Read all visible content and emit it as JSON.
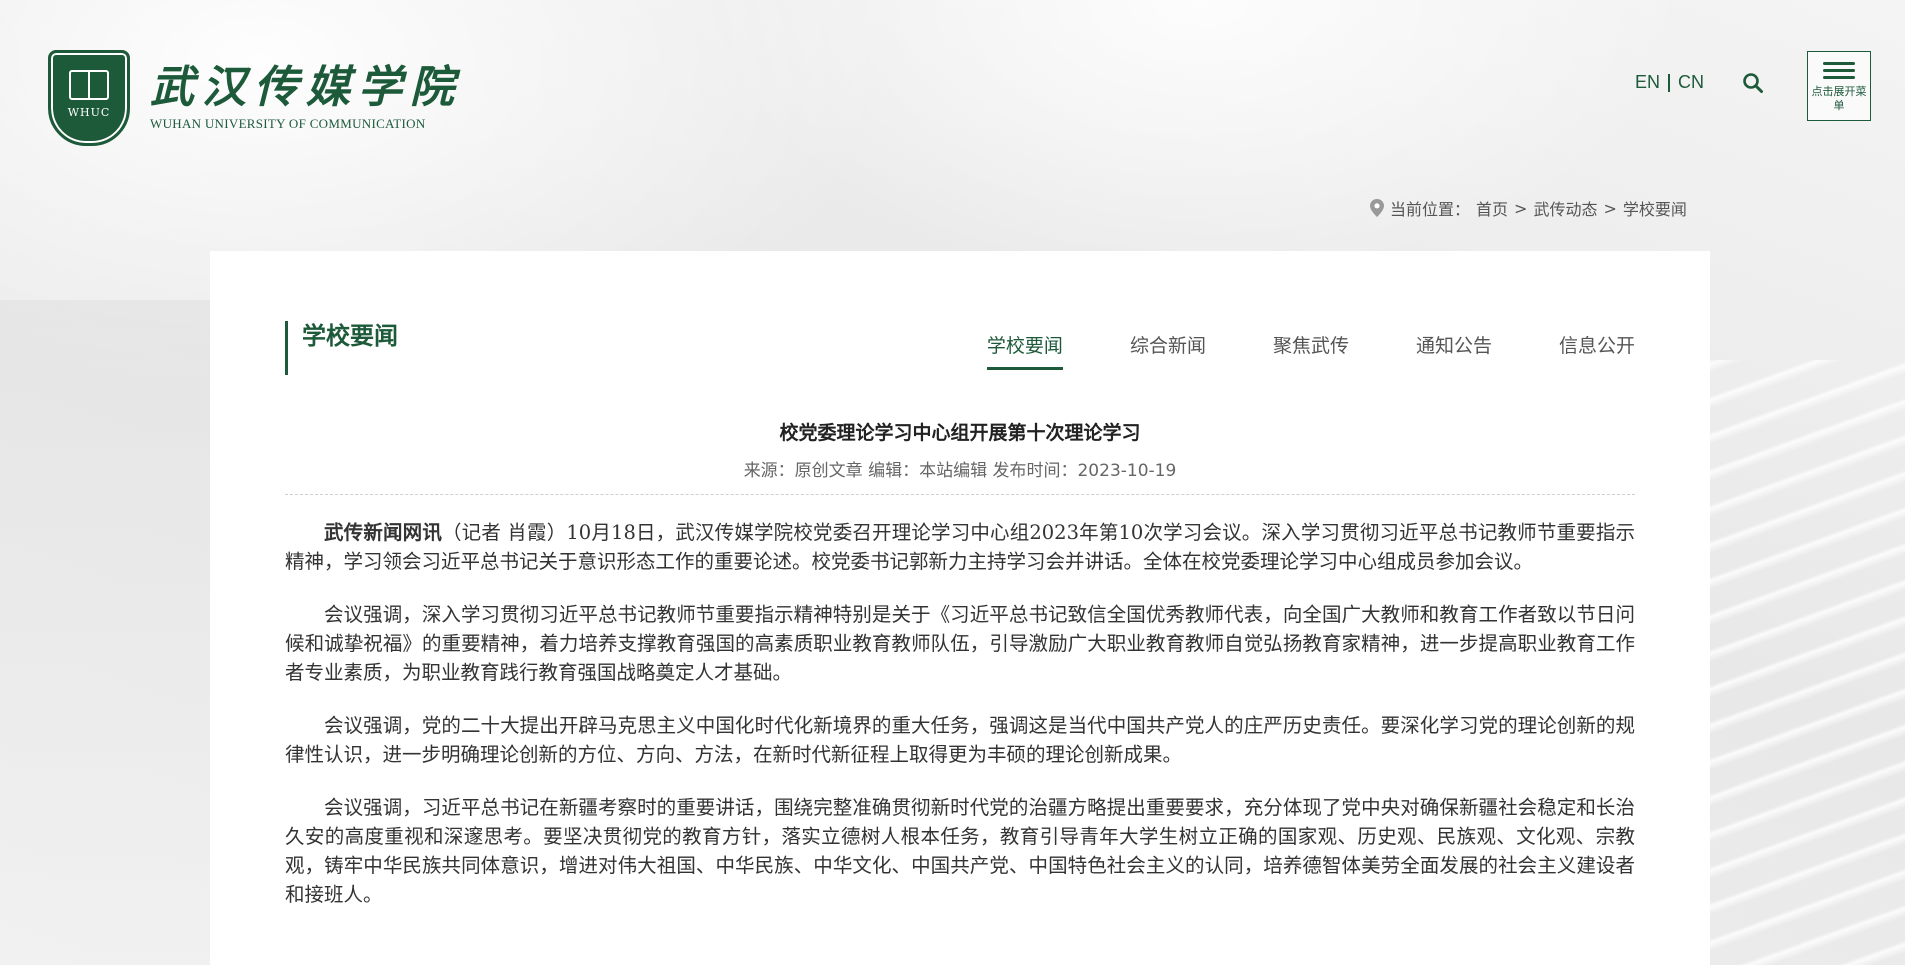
{
  "header": {
    "logo_abbr": "WHUC",
    "logo_cn": "武汉传媒学院",
    "logo_en": "WUHAN UNIVERSITY OF COMMUNICATION",
    "lang_en": "EN",
    "lang_cn": "CN",
    "menu_label": "点击展开菜单",
    "accent_color": "#1d5a3a"
  },
  "breadcrumb": {
    "prefix": "当前位置：",
    "items": [
      "首页",
      "武传动态",
      "学校要闻"
    ],
    "separator": ">"
  },
  "section": {
    "title": "学校要闻",
    "tabs": [
      "学校要闻",
      "综合新闻",
      "聚焦武传",
      "通知公告",
      "信息公开"
    ],
    "active_tab": "学校要闻"
  },
  "article": {
    "title": "校党委理论学习中心组开展第十次理论学习",
    "meta": "来源：原创文章 编辑：本站编辑 发布时间：2023-10-19",
    "lead": "武传新闻网讯",
    "paragraphs": [
      "（记者 肖霞）10月18日，武汉传媒学院校党委召开理论学习中心组2023年第10次学习会议。深入学习贯彻习近平总书记教师节重要指示精神，学习领会习近平总书记关于意识形态工作的重要论述。校党委书记郭新力主持学习会并讲话。全体在校党委理论学习中心组成员参加会议。",
      "会议强调，深入学习贯彻习近平总书记教师节重要指示精神特别是关于《习近平总书记致信全国优秀教师代表，向全国广大教师和教育工作者致以节日问候和诚挚祝福》的重要精神，着力培养支撑教育强国的高素质职业教育教师队伍，引导激励广大职业教育教师自觉弘扬教育家精神，进一步提高职业教育工作者专业素质，为职业教育践行教育强国战略奠定人才基础。",
      "会议强调，党的二十大提出开辟马克思主义中国化时代化新境界的重大任务，强调这是当代中国共产党人的庄严历史责任。要深化学习党的理论创新的规律性认识，进一步明确理论创新的方位、方向、方法，在新时代新征程上取得更为丰硕的理论创新成果。",
      "会议强调，习近平总书记在新疆考察时的重要讲话，围绕完整准确贯彻新时代党的治疆方略提出重要要求，充分体现了党中央对确保新疆社会稳定和长治久安的高度重视和深邃思考。要坚决贯彻党的教育方针，落实立德树人根本任务，教育引导青年大学生树立正确的国家观、历史观、民族观、文化观、宗教观，铸牢中华民族共同体意识，增进对伟大祖国、中华民族、中华文化、中国共产党、中国特色社会主义的认同，培养德智体美劳全面发展的社会主义建设者和接班人。"
    ]
  }
}
